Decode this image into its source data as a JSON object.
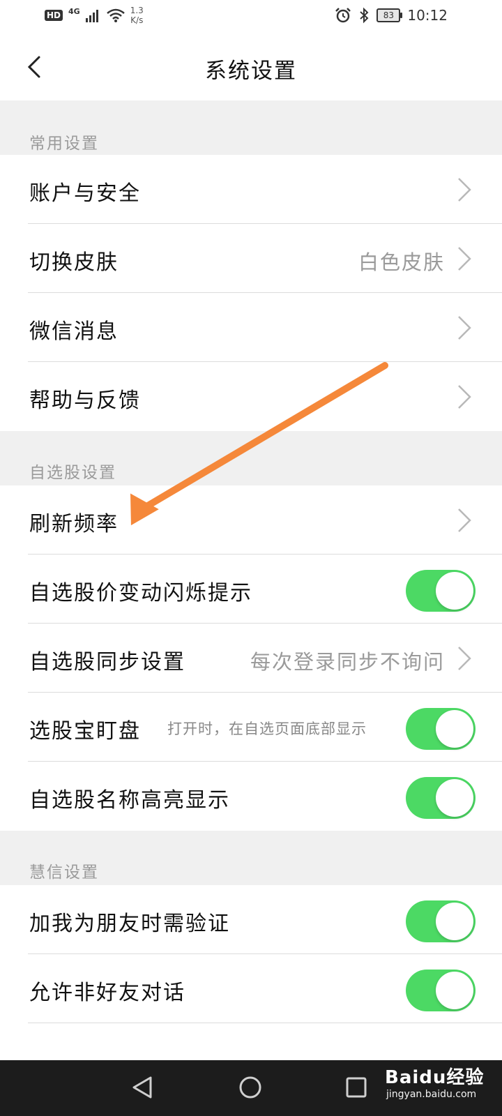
{
  "status_bar": {
    "hd": "HD",
    "network": "4G",
    "speed_value": "1.3",
    "speed_unit": "K/s",
    "battery": "83",
    "time": "10:12"
  },
  "nav": {
    "title": "系统设置"
  },
  "sections": {
    "common": {
      "header": "常用设置",
      "account": "账户与安全",
      "skin": "切换皮肤",
      "skin_value": "白色皮肤",
      "wechat": "微信消息",
      "help": "帮助与反馈"
    },
    "watchlist": {
      "header": "自选股设置",
      "refresh": "刷新频率",
      "flash": "自选股价变动闪烁提示",
      "flash_on": true,
      "sync": "自选股同步设置",
      "sync_value": "每次登录同步不询问",
      "monitor": "选股宝盯盘",
      "monitor_hint": "打开时，在自选页面底部显示",
      "monitor_on": true,
      "highlight": "自选股名称高亮显示",
      "highlight_on": true
    },
    "huixin": {
      "header": "慧信设置",
      "verify": "加我为朋友时需验证",
      "verify_on": true,
      "nonfriend": "允许非好友对话",
      "nonfriend_on": true
    }
  },
  "watermark": {
    "logo": "Baidu经验",
    "url": "jingyan.baidu.com"
  },
  "colors": {
    "toggle_on": "#4cd964",
    "annotation_arrow": "#f5883a",
    "background": "#f0f0f0"
  }
}
